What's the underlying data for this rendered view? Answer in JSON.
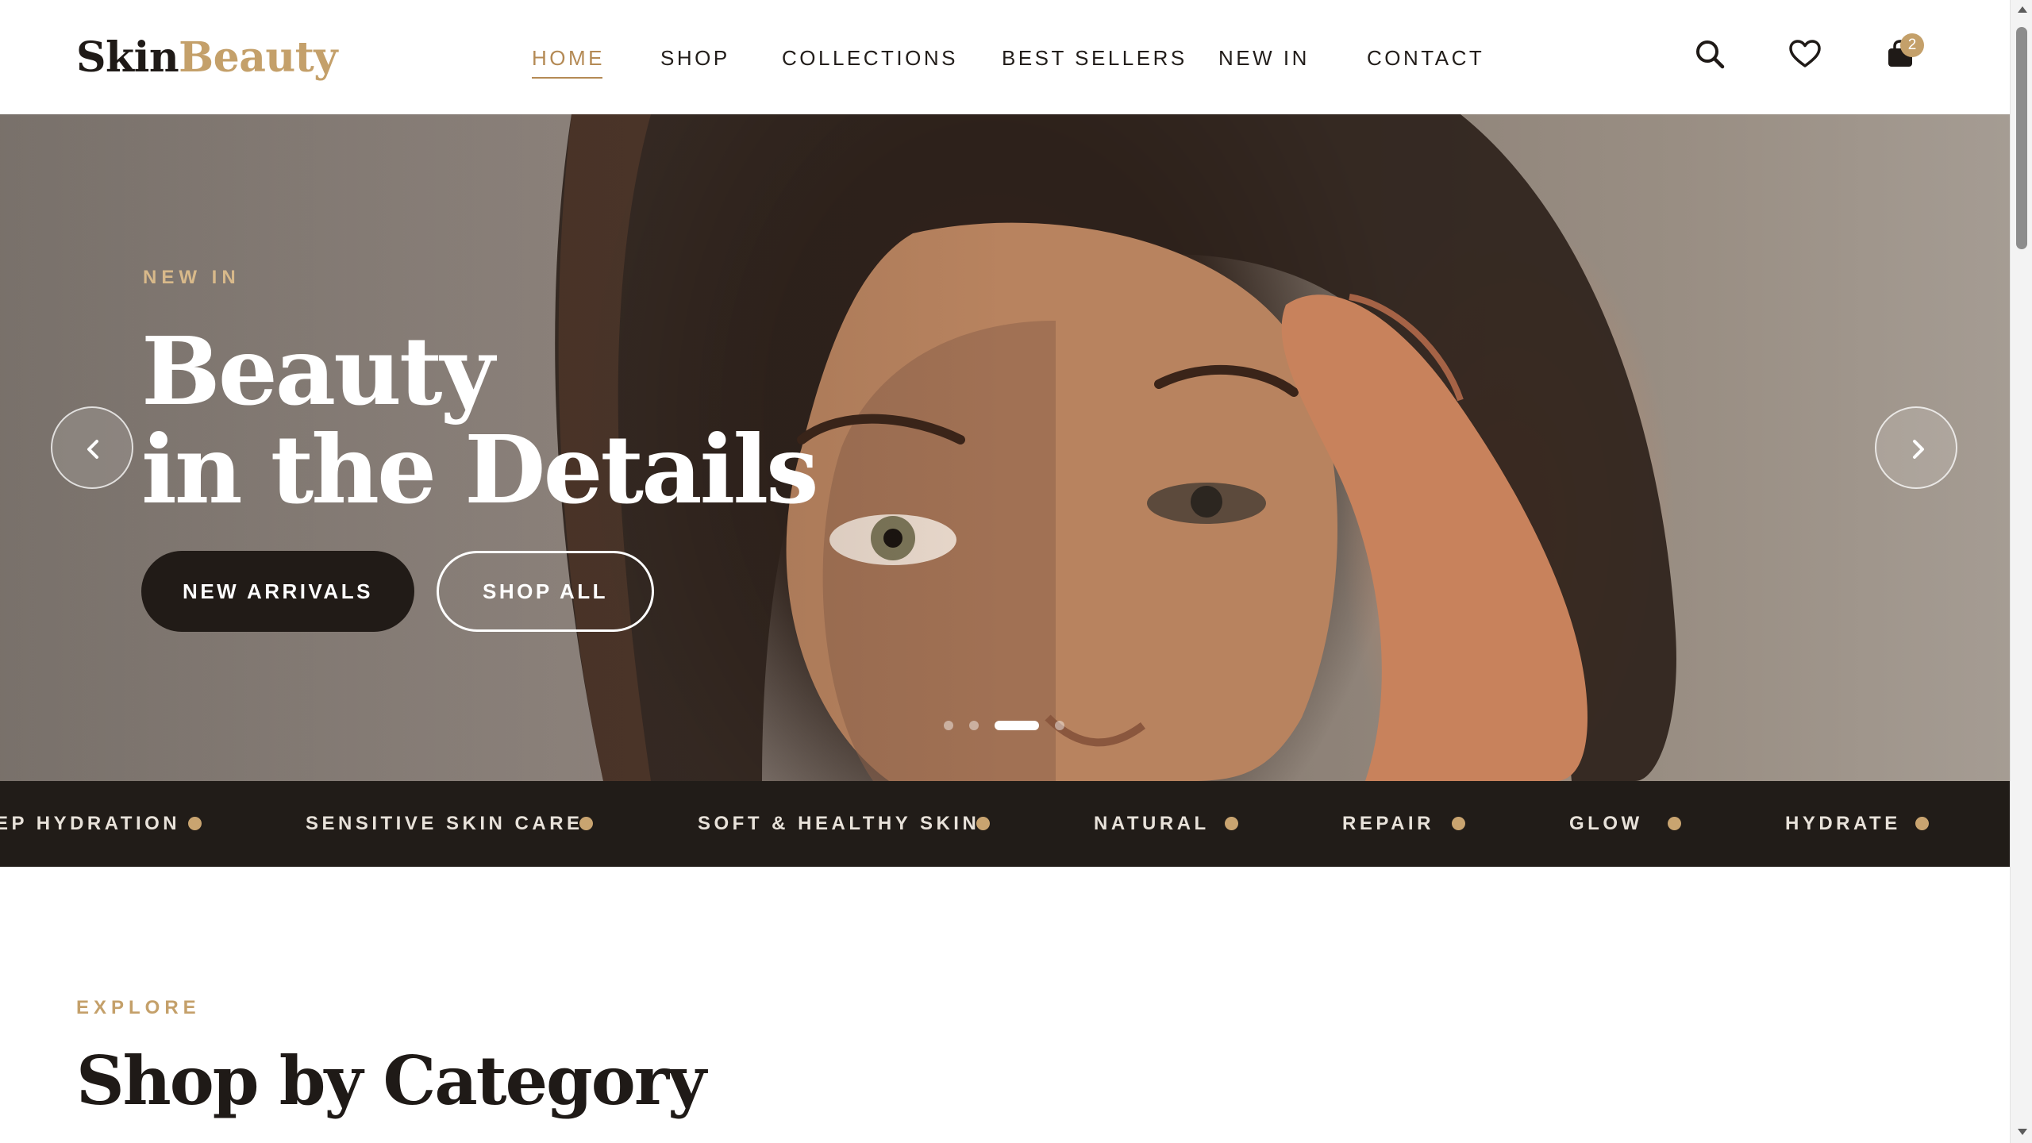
{
  "brand": {
    "part1": "Skin",
    "part2": "Beauty"
  },
  "nav": {
    "items": [
      {
        "label": "HOME",
        "active": true
      },
      {
        "label": "SHOP",
        "active": false
      },
      {
        "label": "COLLECTIONS",
        "active": false
      },
      {
        "label": "BEST SELLERS",
        "active": false
      },
      {
        "label": "NEW IN",
        "active": false
      },
      {
        "label": "CONTACT",
        "active": false
      }
    ]
  },
  "header_icons": {
    "search": "search-icon",
    "wishlist": "heart-icon",
    "cart": "shopping-bag-icon",
    "cart_count": "2"
  },
  "hero": {
    "eyebrow": "NEW IN",
    "title_line1": "Beauty",
    "title_line2": "in the Details",
    "primary_button": "NEW ARRIVALS",
    "secondary_button": "SHOP ALL",
    "prev_icon": "chevron-left-icon",
    "next_icon": "chevron-right-icon",
    "slides_total": 4,
    "active_slide": 3
  },
  "marquee": {
    "items": [
      "EP HYDRATION",
      "SENSITIVE SKIN CARE",
      "SOFT & HEALTHY SKIN",
      "NATURAL",
      "REPAIR",
      "GLOW",
      "HYDRATE"
    ]
  },
  "category_section": {
    "eyebrow": "EXPLORE",
    "title": "Shop by Category"
  },
  "colors": {
    "accent_gold": "#c4a06a",
    "dark": "#211c18",
    "text": "#1f1a17"
  }
}
